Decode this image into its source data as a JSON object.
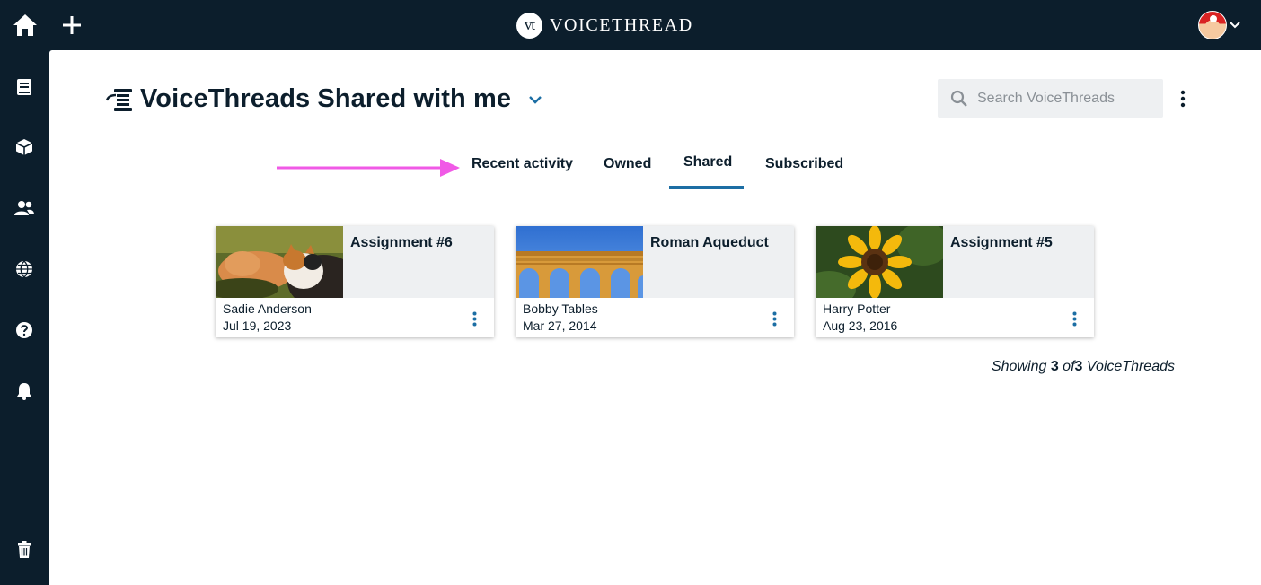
{
  "app": {
    "logo_badge": "vt",
    "logo_text": "VOICETHREAD"
  },
  "header": {
    "title": "VoiceThreads Shared with me",
    "search_placeholder": "Search VoiceThreads"
  },
  "tabs": [
    {
      "label": "Recent activity",
      "active": false
    },
    {
      "label": "Owned",
      "active": false
    },
    {
      "label": "Shared",
      "active": true
    },
    {
      "label": "Subscribed",
      "active": false
    }
  ],
  "cards": [
    {
      "title": "Assignment #6",
      "owner": "Sadie Anderson",
      "date": "Jul 19, 2023",
      "thumbnail": "kittens-photo"
    },
    {
      "title": "Roman Aqueduct",
      "owner": "Bobby Tables",
      "date": "Mar 27, 2014",
      "thumbnail": "aqueduct-photo"
    },
    {
      "title": "Assignment #5",
      "owner": "Harry Potter",
      "date": "Aug 23, 2016",
      "thumbnail": "sunflower-photo"
    }
  ],
  "summary": {
    "prefix": "Showing",
    "shown": "3",
    "of": "of",
    "total": "3",
    "suffix": "VoiceThreads"
  },
  "colors": {
    "navy": "#0c1e2c",
    "accent": "#1c6ea4",
    "annotation_arrow": "#f05ae6",
    "panel_gray": "#eef0f2"
  },
  "icons": {
    "top_left": [
      "home-icon",
      "plus-icon"
    ],
    "sidebar": [
      "library-icon",
      "box-icon",
      "users-icon",
      "globe-icon",
      "help-icon",
      "bell-icon",
      "trash-icon"
    ]
  }
}
